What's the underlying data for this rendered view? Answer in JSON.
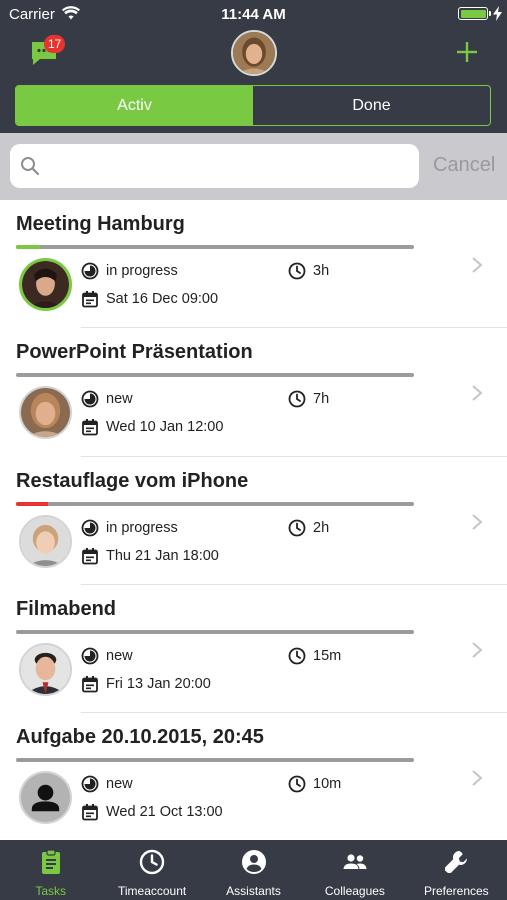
{
  "status_bar": {
    "carrier": "Carrier",
    "time": "11:44 AM"
  },
  "header": {
    "chat_badge": "17",
    "segments": [
      {
        "label": "Activ",
        "active": true
      },
      {
        "label": "Done",
        "active": false
      }
    ]
  },
  "search": {
    "placeholder": "",
    "cancel_label": "Cancel"
  },
  "tasks": [
    {
      "title": "Meeting Hamburg",
      "status": "in progress",
      "duration": "3h",
      "date": "Sat 16 Dec 09:00",
      "progress": 0.06,
      "progress_color": "#7ac943",
      "avatar": "woman-dark-hair"
    },
    {
      "title": "PowerPoint Präsentation",
      "status": "new",
      "duration": "7h",
      "date": "Wed 10 Jan 12:00",
      "progress": 0,
      "progress_color": "#7ac943",
      "avatar": "woman-blonde"
    },
    {
      "title": "Restauflage vom iPhone",
      "status": "in progress",
      "duration": "2h",
      "date": "Thu 21 Jan 18:00",
      "progress": 0.08,
      "progress_color": "#e8332f",
      "avatar": "woman-short-hair"
    },
    {
      "title": "Filmabend",
      "status": "new",
      "duration": "15m",
      "date": "Fri 13 Jan 20:00",
      "progress": 0,
      "progress_color": "#7ac943",
      "avatar": "man-suit"
    },
    {
      "title": "Aufgabe 20.10.2015, 20:45",
      "status": "new",
      "duration": "10m",
      "date": "Wed 21 Oct 13:00",
      "progress": 0,
      "progress_color": "#7ac943",
      "avatar": "placeholder-person"
    }
  ],
  "tabbar": [
    {
      "label": "Tasks",
      "icon": "clipboard-icon",
      "active": true
    },
    {
      "label": "Timeaccount",
      "icon": "clock-icon",
      "active": false
    },
    {
      "label": "Assistants",
      "icon": "person-circle-icon",
      "active": false
    },
    {
      "label": "Colleagues",
      "icon": "people-icon",
      "active": false
    },
    {
      "label": "Preferences",
      "icon": "wrench-icon",
      "active": false
    }
  ],
  "colors": {
    "accent": "#7ac943",
    "header_bg": "#373b45",
    "alert": "#e8332f"
  }
}
